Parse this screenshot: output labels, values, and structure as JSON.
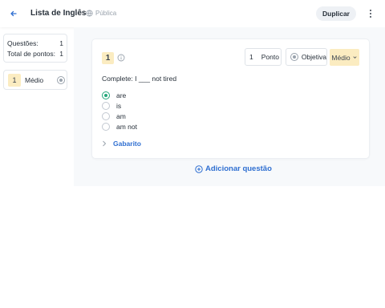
{
  "header": {
    "title": "Lista de Inglês",
    "visibility": "Pública",
    "duplicate_label": "Duplicar",
    "back_icon": "arrow-left-icon",
    "more_icon": "dots-vertical-icon",
    "globe_icon": "globe-icon"
  },
  "sidebar": {
    "summary": {
      "questions_label": "Questões:",
      "questions_value": "1",
      "points_label": "Total de pontos:",
      "points_value": "1"
    },
    "questions": [
      {
        "number": "1",
        "difficulty": "Médio"
      }
    ]
  },
  "question": {
    "number": "1",
    "points_value": "1",
    "points_unit": "Ponto",
    "type": "Objetiva",
    "difficulty": "Médio",
    "statement": "Complete: I ___ not tired",
    "options": [
      {
        "text": "are",
        "selected": true
      },
      {
        "text": "is",
        "selected": false
      },
      {
        "text": "am",
        "selected": false
      },
      {
        "text": "am not",
        "selected": false
      }
    ],
    "answer_key_label": "Gabarito"
  },
  "add_question_label": "Adicionar questão",
  "colors": {
    "accent": "#2f6fd1",
    "correct": "#24a77a",
    "badge": "#fbecc1"
  }
}
